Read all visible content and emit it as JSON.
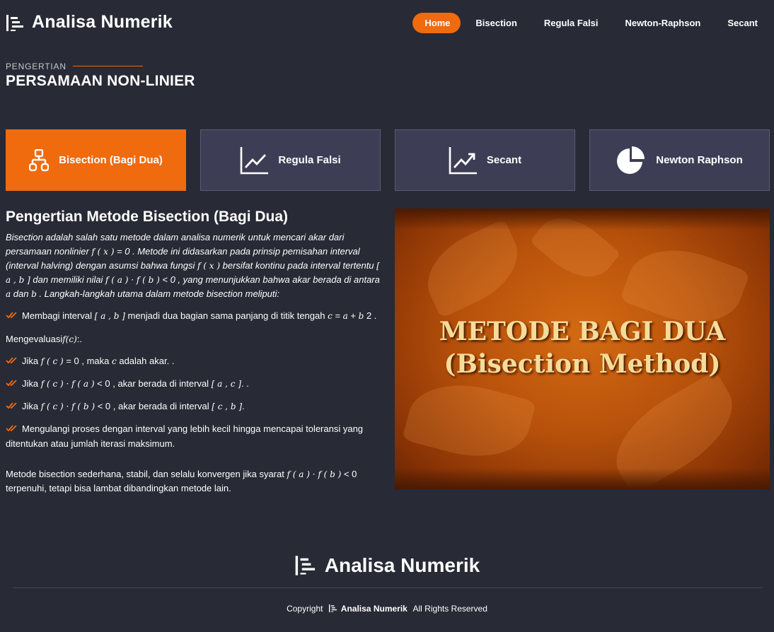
{
  "header": {
    "brand": "Analisa Numerik",
    "nav": [
      {
        "label": "Home",
        "active": true
      },
      {
        "label": "Bisection",
        "active": false
      },
      {
        "label": "Regula Falsi",
        "active": false
      },
      {
        "label": "Newton-Raphson",
        "active": false
      },
      {
        "label": "Secant",
        "active": false
      }
    ]
  },
  "section": {
    "subtitle": "PENGERTIAN",
    "title": "PERSAMAAN NON-LINIER"
  },
  "cards": [
    {
      "label": "Bisection (Bagi Dua)",
      "icon": "sitemap-icon",
      "active": true
    },
    {
      "label": "Regula Falsi",
      "icon": "line-chart-icon",
      "active": false
    },
    {
      "label": "Secant",
      "icon": "area-chart-icon",
      "active": false
    },
    {
      "label": "Newton Raphson",
      "icon": "pie-chart-icon",
      "active": false
    }
  ],
  "article": {
    "heading": "Pengertian Metode Bisection (Bagi Dua)",
    "intro": {
      "t1": "Bisection adalah salah satu metode dalam analisa numerik untuk mencari akar dari persamaan nonlinier ",
      "m1": "f ( x )",
      "t2": " = 0 . Metode ini didasarkan pada prinsip pemisahan interval (interval halving) dengan asumsi bahwa fungsi ",
      "m2": "f ( x )",
      "t3": " bersifat kontinu pada interval tertentu ",
      "m3": "[ a , b ]",
      "t4": " dan memiliki nilai ",
      "m4": "f ( a ) · f ( b )",
      "t5": " < 0 , yang menunjukkan bahwa akar berada di antara ",
      "m5": "a",
      "t6": " dan ",
      "m6": "b",
      "t7": " . Langkah-langkah utama dalam metode bisection meliputi:"
    },
    "step1": {
      "t1": "Membagi interval ",
      "m1": "[ a , b ]",
      "t2": " menjadi dua bagian sama panjang di titik tengah ",
      "m2": "c",
      "t3": " = ",
      "m3": "a",
      "t4": " + ",
      "m4": "b",
      "t5": " 2 ."
    },
    "evaluate": {
      "t1": "Mengevaluasi",
      "m1": "f(c)",
      "t2": ":."
    },
    "step2": {
      "t1": "Jika ",
      "m1": "f ( c )",
      "t2": " = 0 , maka ",
      "m2": "c",
      "t3": " adalah akar. ."
    },
    "step3": {
      "t1": "Jika ",
      "m1": "f ( c ) · f ( a )",
      "t2": " < 0 , akar berada di interval ",
      "m2": "[ a , c ]",
      "t3": ". ."
    },
    "step4": {
      "t1": "Jika ",
      "m1": "f ( c ) · f ( b )",
      "t2": " < 0 , akar berada di interval ",
      "m2": "[ c , b ]",
      "t3": "."
    },
    "step5": {
      "t1": "Mengulangi proses dengan interval yang lebih kecil hingga mencapai toleransi yang ditentukan atau jumlah iterasi maksimum."
    },
    "closing": {
      "t1": "Metode bisection sederhana, stabil, dan selalu konvergen jika syarat ",
      "m1": "f ( a ) · f ( b )",
      "t2": " < 0 terpenuhi, tetapi bisa lambat dibandingkan metode lain."
    }
  },
  "banner": {
    "line1": "METODE BAGI DUA",
    "line2": "(Bisection Method)"
  },
  "footer": {
    "brand": "Analisa Numerik",
    "copyright_prefix": "Copyright",
    "copyright_brand": "Analisa Numerik",
    "copyright_suffix": "All Rights Reserved"
  },
  "colors": {
    "background": "#282a35",
    "accent": "#f06a0e",
    "card": "#3d3e55"
  }
}
